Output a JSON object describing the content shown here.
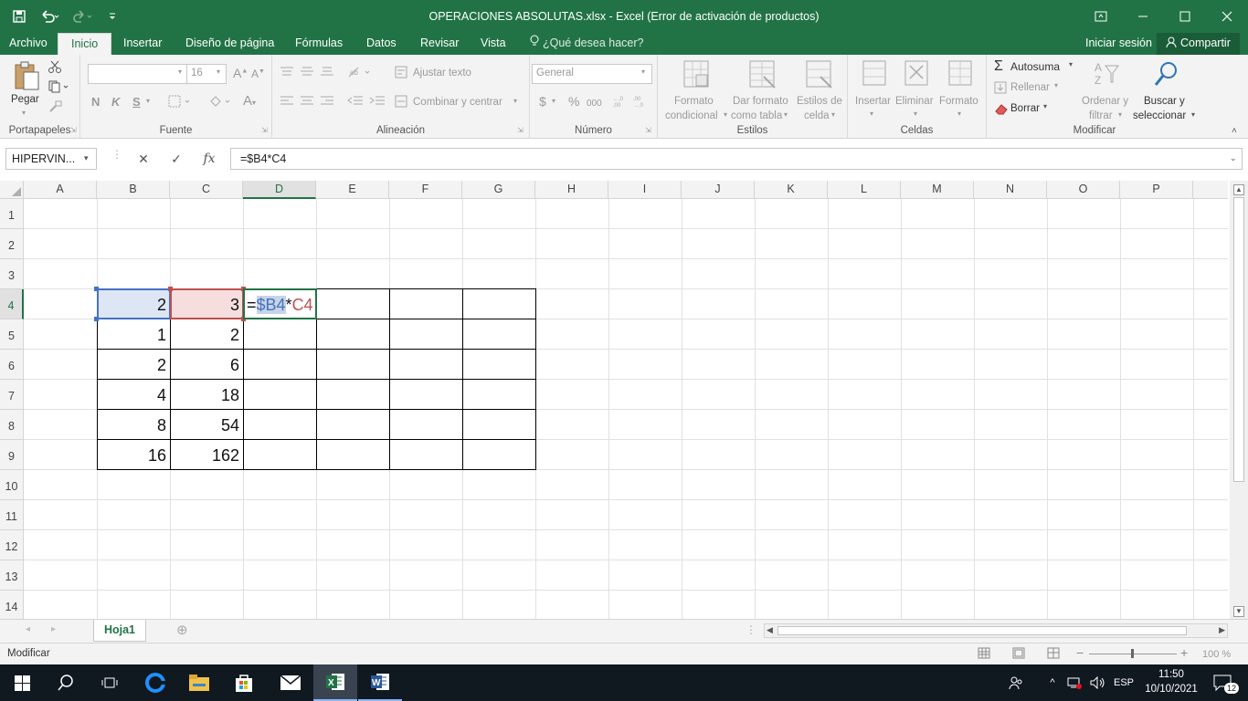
{
  "window": {
    "title": "OPERACIONES ABSOLUTAS.xlsx - Excel (Error de activación de productos)"
  },
  "tabs": {
    "archivo": "Archivo",
    "inicio": "Inicio",
    "insertar": "Insertar",
    "diseno": "Diseño de página",
    "formulas": "Fórmulas",
    "datos": "Datos",
    "revisar": "Revisar",
    "vista": "Vista",
    "tell_me": "¿Qué desea hacer?",
    "signin": "Iniciar sesión",
    "share": "Compartir"
  },
  "ribbon": {
    "pegar": "Pegar",
    "portapapeles": "Portapapeles",
    "font_name": "",
    "font_size": "16",
    "bold": "N",
    "italic": "K",
    "underline": "S",
    "fuente": "Fuente",
    "ajustar": "Ajustar texto",
    "combinar": "Combinar y centrar",
    "alineacion": "Alineación",
    "number_format": "General",
    "currency": "$",
    "percent": "%",
    "thousands": "000",
    "numero": "Número",
    "fc1": "Formato",
    "fc2": "condicional",
    "dt1": "Dar formato",
    "dt2": "como tabla",
    "ec1": "Estilos de",
    "ec2": "celda",
    "estilos": "Estilos",
    "ins": "Insertar",
    "elim": "Eliminar",
    "form": "Formato",
    "celdas": "Celdas",
    "autosuma": "Autosuma",
    "rellenar": "Rellenar",
    "borrar": "Borrar",
    "ord1": "Ordenar y",
    "ord2": "filtrar",
    "bus1": "Buscar y",
    "bus2": "seleccionar",
    "modificar": "Modificar"
  },
  "formula_bar": {
    "name_box": "HIPERVIN...",
    "fx": "fx",
    "formula": "=$B4*C4"
  },
  "grid": {
    "columns": [
      "A",
      "B",
      "C",
      "D",
      "E",
      "F",
      "G",
      "H",
      "I",
      "J",
      "K",
      "L",
      "M",
      "N",
      "O",
      "P"
    ],
    "rows": [
      "1",
      "2",
      "3",
      "4",
      "5",
      "6",
      "7",
      "8",
      "9",
      "10",
      "11",
      "12",
      "13",
      "14"
    ],
    "b_values": [
      "2",
      "1",
      "2",
      "4",
      "8",
      "16"
    ],
    "c_values": [
      "3",
      "2",
      "6",
      "18",
      "54",
      "162"
    ],
    "edit": {
      "eq": "=",
      "ref1": "$B4",
      "op": "*",
      "ref2": "C4"
    }
  },
  "sheets": {
    "active": "Hoja1"
  },
  "status": {
    "mode": "Modificar",
    "zoom": "100 %"
  },
  "taskbar": {
    "lang": "ESP",
    "time": "11:50",
    "date": "10/10/2021",
    "notif": "12"
  },
  "colors": {
    "excel_green": "#217346",
    "ref_blue": "#4472c4",
    "ref_red": "#c0504d"
  }
}
